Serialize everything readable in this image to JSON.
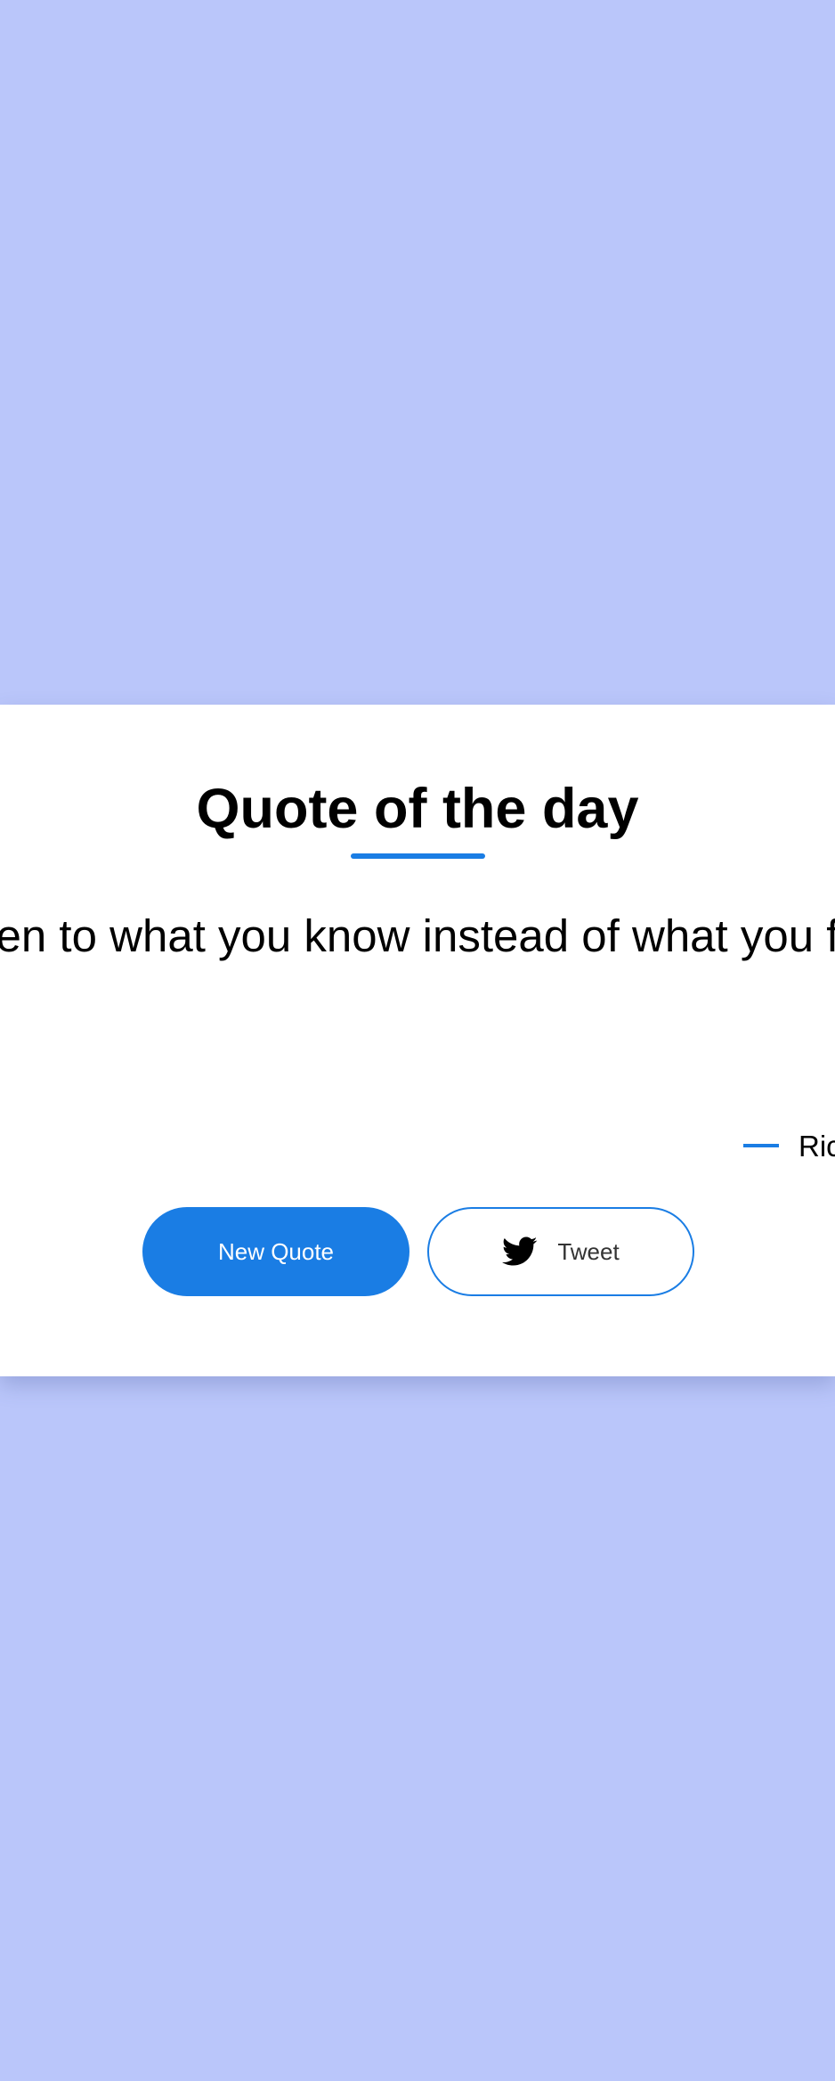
{
  "colors": {
    "page_background": "#bac6fa",
    "card_background": "#ffffff",
    "accent": "#1a7de4",
    "text": "#000000"
  },
  "card": {
    "title": "Quote of the day",
    "quote_text": "en to what you know instead of what you f",
    "author": "Ric"
  },
  "buttons": {
    "new_quote_label": "New Quote",
    "tweet_label": "Tweet",
    "tweet_icon": "twitter-bird-icon"
  }
}
